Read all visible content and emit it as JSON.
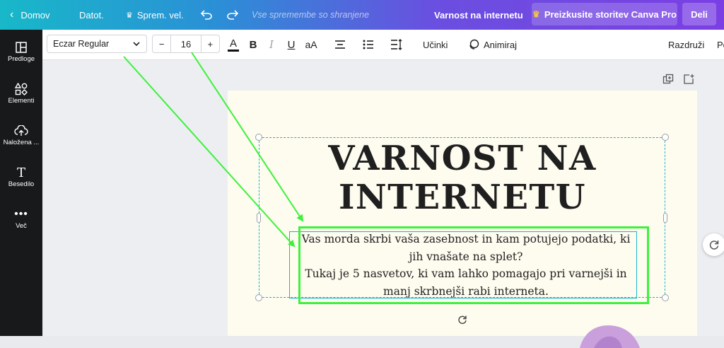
{
  "topbar": {
    "home": "Domov",
    "file": "Datot.",
    "resize": "Sprem. vel.",
    "saved_status": "Vse spremembe so shranjene",
    "doc_title": "Varnost na internetu",
    "pro_trial": "Preizkusite storitev Canva Pro",
    "share": "Deli"
  },
  "sidebar": {
    "items": [
      {
        "label": "Predloge",
        "icon": "template-icon"
      },
      {
        "label": "Elementi",
        "icon": "elements-icon"
      },
      {
        "label": "Naložena ...",
        "icon": "upload-icon"
      },
      {
        "label": "Besedilo",
        "icon": "text-icon"
      },
      {
        "label": "Več",
        "icon": "more-icon"
      }
    ]
  },
  "toolbar": {
    "font_family": "Eczar Regular",
    "font_size": "16",
    "minus": "−",
    "plus": "+",
    "text_color_glyph": "A",
    "bold_glyph": "B",
    "italic_glyph": "I",
    "underline_glyph": "U",
    "case_glyph": "aA",
    "effects": "Učinki",
    "animate": "Animiraj",
    "ungroup": "Razdruži",
    "position": "Po"
  },
  "canvas": {
    "heading_line1": "VARNOST NA",
    "heading_line2": "INTERNETU",
    "body_line1": "Vas morda skrbi vaša zasebnost in kam potujejo podatki, ki",
    "body_line2": "jih vnašate na splet?",
    "body_line3": "Tukaj je 5 nasvetov, ki vam lahko pomagajo pri varnejši in",
    "body_line4": "manj skrbnejši rabi interneta."
  },
  "colors": {
    "selection": "#14b8cc",
    "annotation": "#3cf23c",
    "page_bg": "#fefbef",
    "sidebar_bg": "#18191b"
  }
}
